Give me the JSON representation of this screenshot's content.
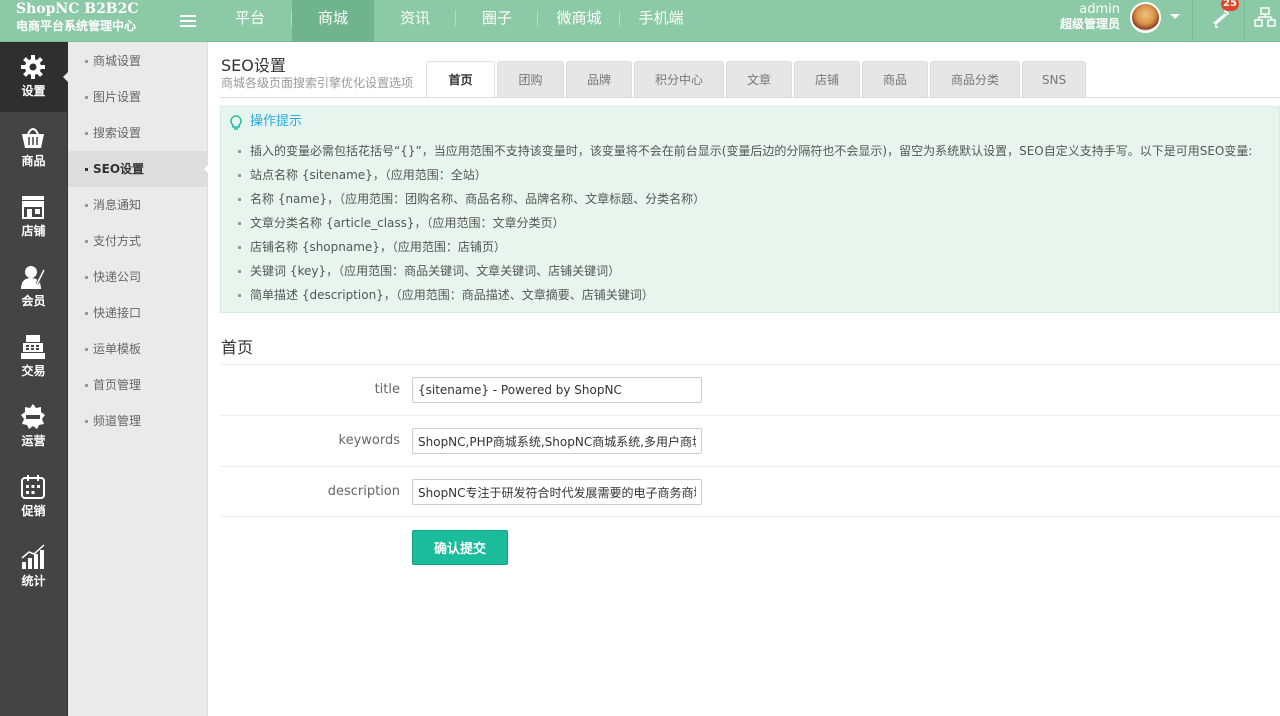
{
  "brand": {
    "name": "ShopNC B2B2C",
    "subtitle": "电商平台系统管理中心"
  },
  "topnav": {
    "items": [
      {
        "label": "平台"
      },
      {
        "label": "商城"
      },
      {
        "label": "资讯"
      },
      {
        "label": "圈子"
      },
      {
        "label": "微商城"
      },
      {
        "label": "手机端"
      }
    ],
    "active_index": 1
  },
  "user": {
    "name": "admin",
    "role": "超级管理员",
    "notification_count": "25"
  },
  "leftbar": {
    "items": [
      {
        "label": "设置",
        "icon": "gear-icon"
      },
      {
        "label": "商品",
        "icon": "basket-icon"
      },
      {
        "label": "店铺",
        "icon": "store-icon"
      },
      {
        "label": "会员",
        "icon": "member-icon"
      },
      {
        "label": "交易",
        "icon": "cash-register-icon"
      },
      {
        "label": "运营",
        "icon": "sale-badge-icon"
      },
      {
        "label": "促销",
        "icon": "calendar-icon"
      },
      {
        "label": "统计",
        "icon": "bar-chart-icon"
      }
    ],
    "active_index": 0
  },
  "submenu": {
    "items": [
      {
        "label": "商城设置"
      },
      {
        "label": "图片设置"
      },
      {
        "label": "搜索设置"
      },
      {
        "label": "SEO设置"
      },
      {
        "label": "消息通知"
      },
      {
        "label": "支付方式"
      },
      {
        "label": "快递公司"
      },
      {
        "label": "快递接口"
      },
      {
        "label": "运单模板"
      },
      {
        "label": "首页管理"
      },
      {
        "label": "频道管理"
      }
    ],
    "active_index": 3
  },
  "page": {
    "title": "SEO设置",
    "description": "商城各级页面搜索引擎优化设置选项"
  },
  "tabs": [
    {
      "label": "首页"
    },
    {
      "label": "团购"
    },
    {
      "label": "品牌"
    },
    {
      "label": "积分中心"
    },
    {
      "label": "文章"
    },
    {
      "label": "店铺"
    },
    {
      "label": "商品"
    },
    {
      "label": "商品分类"
    },
    {
      "label": "SNS"
    }
  ],
  "tips": {
    "title": "操作提示",
    "items": [
      "插入的变量必需包括花括号“{}”，当应用范围不支持该变量时，该变量将不会在前台显示(变量后边的分隔符也不会显示)，留空为系统默认设置，SEO自定义支持手写。以下是可用SEO变量:",
      "站点名称 {sitename}，（应用范围：全站）",
      "名称 {name}，（应用范围：团购名称、商品名称、品牌名称、文章标题、分类名称）",
      "文章分类名称 {article_class}，（应用范围：文章分类页）",
      "店铺名称 {shopname}，（应用范围：店铺页）",
      "关键词 {key}，（应用范围：商品关键词、文章关键词、店铺关键词）",
      "简单描述 {description}，（应用范围：商品描述、文章摘要、店铺关键词）"
    ]
  },
  "form": {
    "section_title": "首页",
    "fields": [
      {
        "label": "title",
        "value": "{sitename} - Powered by ShopNC"
      },
      {
        "label": "keywords",
        "value": "ShopNC,PHP商城系统,ShopNC商城系统,多用户商城系统,电商ERP,电商CRM,电子商务解决方案"
      },
      {
        "label": "description",
        "value": "ShopNC专注于研发符合时代发展需要的电子商务商城系统，以专业化的服务水平为企业级用户提供B(2B)2C【B2B2C】电子商务平台解决方案，全力打造电商平台专项ERP(CRM)系统、ERP(RFID)系统等，引领中国电子商务行业企业级需求的发展方向。咨询电话：400-611-5098"
      }
    ],
    "submit_label": "确认提交"
  },
  "colors": {
    "topbar": "#8cc9a6",
    "topnav_active": "#6fb48c",
    "leftbar": "#444444",
    "submenu": "#eaeaea",
    "tips_bg": "#e8f5ee",
    "tips_title": "#27a9e3",
    "submit": "#1bbc9b",
    "badge": "#e4442c"
  }
}
